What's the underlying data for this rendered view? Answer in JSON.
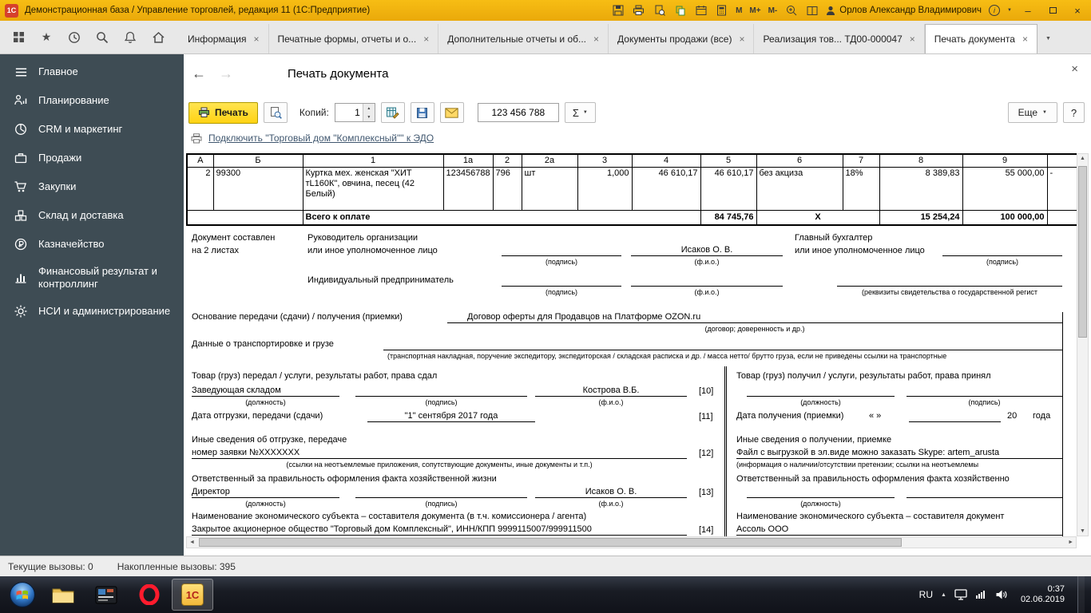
{
  "glyphs": {
    "close": "×",
    "back": "←",
    "forward": "→",
    "up": "▲",
    "down": "▼",
    "left": "◄",
    "right": "►",
    "sum": "Σ",
    "help": "?",
    "star": "★",
    "info": "i",
    "minimize": "–"
  },
  "title_bar": {
    "logo": "1С",
    "title": "Демонстрационная база / Управление торговлей, редакция 11 (1С:Предприятие)",
    "memory": {
      "m": "M",
      "m_plus": "M+",
      "m_minus": "M-"
    },
    "user": "Орлов Александр Владимирович"
  },
  "tab_bar": {
    "tabs": [
      {
        "label": "Информация"
      },
      {
        "label": "Печатные формы, отчеты и о..."
      },
      {
        "label": "Дополнительные отчеты и об..."
      },
      {
        "label": "Документы продажи (все)"
      },
      {
        "label": "Реализация тов... ТД00-000047"
      },
      {
        "label": "Печать документа"
      }
    ]
  },
  "sidebar": {
    "items": [
      {
        "label": "Главное"
      },
      {
        "label": "Планирование"
      },
      {
        "label": "CRM и маркетинг"
      },
      {
        "label": "Продажи"
      },
      {
        "label": "Закупки"
      },
      {
        "label": "Склад и доставка"
      },
      {
        "label": "Казначейство"
      },
      {
        "label": "Финансовый результат и контроллинг"
      },
      {
        "label": "НСИ и администрирование"
      }
    ]
  },
  "page": {
    "title": "Печать документа",
    "toolbar": {
      "print": "Печать",
      "copies_label": "Копий:",
      "copies_value": "1",
      "number_value": "123 456 788",
      "more": "Еще"
    },
    "edo_link": "Подключить \"Торговый дом \"Комплексный\"\" к ЭДО"
  },
  "document": {
    "table": {
      "headers": [
        "А",
        "Б",
        "1",
        "1а",
        "2",
        "2а",
        "3",
        "4",
        "5",
        "6",
        "7",
        "8",
        "9"
      ],
      "row": [
        "2",
        "99300",
        "Куртка мех. женская \"ХИТ тL160К\", овчина, песец (42 Белый)",
        "123456788",
        "796",
        "шт",
        "1,000",
        "46 610,17",
        "46 610,17",
        "без акциза",
        "18%",
        "8 389,83",
        "55 000,00",
        "-"
      ],
      "total": {
        "label": "Всего к оплате",
        "sum": "84 745,76",
        "x": "Х",
        "vat": "15 254,24",
        "total": "100 000,00"
      }
    },
    "captions": {
      "sign": "(подпись)",
      "name": "(ф.и.о.)",
      "position": "(должность)"
    },
    "composed": {
      "l1": "Документ составлен",
      "l2": "на 2 листах"
    },
    "heads": {
      "dir1": "Руководитель организации",
      "dir2": "или иное уполномоченное лицо",
      "dir_name": "Исаков О. В.",
      "acc1": "Главный бухгалтер",
      "acc2": "или иное уполномоченное лицо",
      "ip": "Индивидуальный предприниматель",
      "ip_right": "(реквизиты свидетельства о государственной  регист"
    },
    "basis": {
      "label": "Основание передачи (сдачи) / получения (приемки)",
      "value": "Договор оферты для Продавцов на Платформе OZON.ru",
      "cap": "(договор; доверенность и др.)"
    },
    "transport": {
      "label": "Данные о транспортировке и грузе",
      "cap": "(транспортная накладная, поручение экспедитору, экспедиторская / складская расписка и др. / масса нетто/ брутто груза, если не приведены ссылки на транспортные"
    },
    "left": {
      "title": "Товар (груз) передал / услуги, результаты работ, права сдал",
      "position": "Заведующая складом",
      "person": "Кострова В.Б.",
      "r10": "[10]",
      "date_label": "Дата отгрузки, передачи (сдачи)",
      "date_value": "\"1\" сентября 2017 года",
      "r11": "[11]",
      "other_label": "Иные сведения об отгрузке, передаче",
      "other_value": "номер заявки №XXXXXXX",
      "r12": "[12]",
      "other_cap": "(ссылки на неотъемлемые приложения, сопутствующие документы, иные документы и т.п.)",
      "resp_label": "Ответственный за правильность оформления факта хозяйственной жизни",
      "resp_position": "Директор",
      "resp_person": "Исаков О. В.",
      "r13": "[13]",
      "entity_label": "Наименование экономического субъекта – составителя документа (в т.ч. комиссионера / агента)",
      "entity_value": "Закрытое акционерное общество \"Торговый дом Комплексный\", ИНН/КПП 9999115007/999911500",
      "r14": "[14]"
    },
    "right": {
      "title": "Товар (груз) получил / услуги, результаты работ, права принял",
      "date_label": "Дата получения (приемки)",
      "date_quotes": "«     »",
      "date_year": "20",
      "date_year_suffix": "года",
      "other_label": "Иные сведения о получении, приемке",
      "other_value": "Файл с выгрузкой в эл.виде можно заказать Skype: artem_arusta",
      "other_cap": "(информация о наличии/отсутствии претензии; ссылки на неотъемлемы",
      "resp_label": "Ответственный за правильность оформления факта хозяйственно",
      "entity_label": "Наименование экономического субъекта – составителя документ",
      "entity_value": "Ассоль ООО"
    }
  },
  "status_bar": {
    "current": "Текущие вызовы: 0",
    "accumulated": "Накопленные вызовы: 395"
  },
  "taskbar": {
    "lang": "RU",
    "time": "0:37",
    "date": "02.06.2019"
  }
}
